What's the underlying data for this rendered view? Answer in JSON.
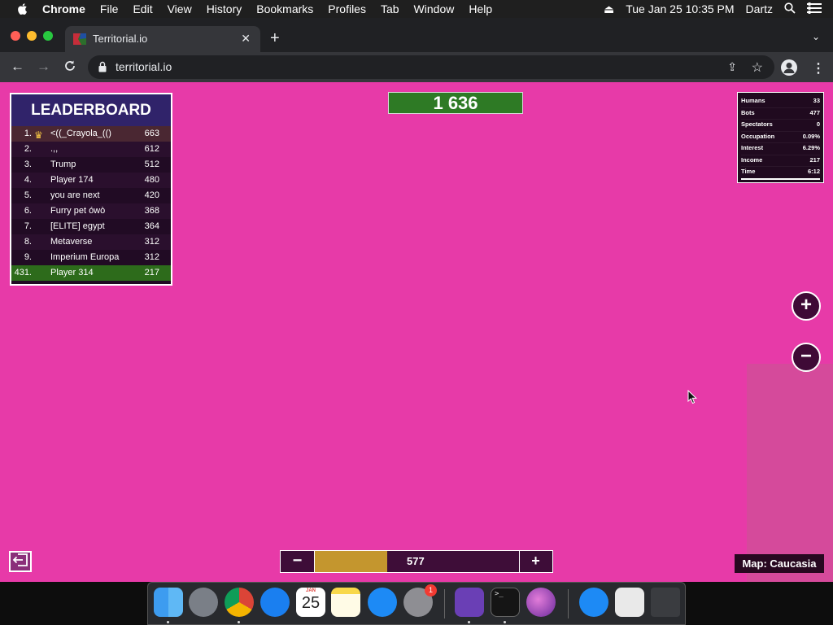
{
  "menubar": {
    "app_name": "Chrome",
    "items": [
      "File",
      "Edit",
      "View",
      "History",
      "Bookmarks",
      "Profiles",
      "Tab",
      "Window",
      "Help"
    ],
    "datetime": "Tue Jan 25  10:35 PM",
    "user": "Dartz"
  },
  "browser": {
    "tab_title": "Territorial.io",
    "url": "territorial.io"
  },
  "game": {
    "leaderboard": {
      "title": "LEADERBOARD",
      "rows": [
        {
          "rank": "1.",
          "name": "<((_Crayola_(()",
          "score": "663"
        },
        {
          "rank": "2.",
          "name": ".,,",
          "score": "612"
        },
        {
          "rank": "3.",
          "name": "Trump",
          "score": "512"
        },
        {
          "rank": "4.",
          "name": "Player 174",
          "score": "480"
        },
        {
          "rank": "5.",
          "name": "you are next",
          "score": "420"
        },
        {
          "rank": "6.",
          "name": "Furry pet ówò",
          "score": "368"
        },
        {
          "rank": "7.",
          "name": "[ELITE] egypt",
          "score": "364"
        },
        {
          "rank": "8.",
          "name": "Metaverse",
          "score": "312"
        },
        {
          "rank": "9.",
          "name": "Imperium Europa",
          "score": "312"
        },
        {
          "rank": "431.",
          "name": "Player 314",
          "score": "217"
        }
      ]
    },
    "score_counter": "1 636",
    "stats": [
      {
        "label": "Humans",
        "value": "33"
      },
      {
        "label": "Bots",
        "value": "477"
      },
      {
        "label": "Spectators",
        "value": "0"
      },
      {
        "label": "Occupation",
        "value": "0.09%"
      },
      {
        "label": "Interest",
        "value": "6.29%"
      },
      {
        "label": "Income",
        "value": "217"
      },
      {
        "label": "Time",
        "value": "6:12"
      }
    ],
    "zoom_in": "+",
    "zoom_out": "−",
    "troops": {
      "minus": "−",
      "value": "577",
      "plus": "+",
      "fill_fraction": 0.3
    },
    "map_label": "Map: Caucasia"
  },
  "dock": {
    "apps": [
      "finder-icon",
      "launchpad-icon",
      "chrome-icon",
      "safari-icon",
      "calendar-icon",
      "notes-icon",
      "app-store-icon",
      "system-preferences-icon",
      "visual-studio-icon",
      "terminal-icon",
      "installer-icon",
      "app-store-downloads-icon",
      "document-icon",
      "trash-icon"
    ],
    "calendar_month": "JAN",
    "calendar_day": "25",
    "system_prefs_badge": "1"
  },
  "colors": {
    "game_background": "#e73aa8",
    "leaderboard_self": "#2d6b1b",
    "score_counter": "#2e7a25",
    "troop_fill": "#c4962e"
  }
}
